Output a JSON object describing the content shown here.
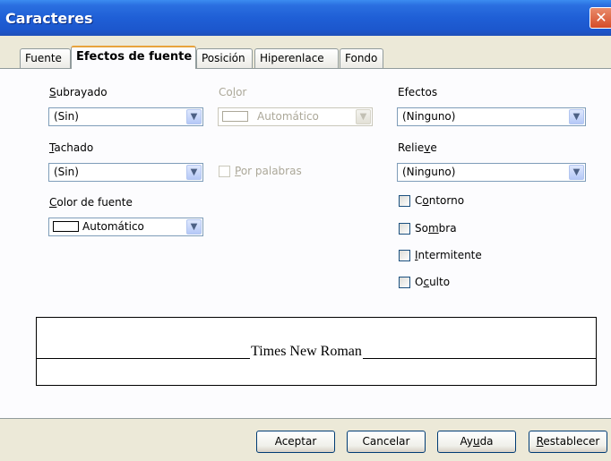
{
  "window": {
    "title": "Caracteres",
    "close_icon": "close-icon"
  },
  "tabs": [
    {
      "label": "Fuente",
      "active": false
    },
    {
      "label": "Efectos de fuente",
      "active": true
    },
    {
      "label": "Posición",
      "active": false
    },
    {
      "label": "Hiperenlace",
      "active": false
    },
    {
      "label": "Fondo",
      "active": false
    }
  ],
  "fields": {
    "underline": {
      "label_u": "S",
      "label_rest": "ubrayado",
      "value": "(Sin)"
    },
    "color": {
      "label_a": "Co",
      "label_u": "l",
      "label_b": "or",
      "value": "Automático",
      "disabled": true
    },
    "effects": {
      "label": "Efectos",
      "value": "(Ninguno)"
    },
    "strikeout": {
      "label_u": "T",
      "label_rest": "achado",
      "value": "(Sin)"
    },
    "by_words": {
      "label_u": "P",
      "label_rest": "or palabras",
      "checked": false,
      "disabled": true
    },
    "relief": {
      "label_a": "Relie",
      "label_u": "v",
      "label_b": "e",
      "value": "(Ninguno)"
    },
    "font_color": {
      "label_u": "C",
      "label_rest": "olor de fuente",
      "value": "Automático"
    },
    "checks": [
      {
        "label_a": "C",
        "label_u": "o",
        "label_b": "ntorno",
        "checked": false
      },
      {
        "label_a": "So",
        "label_u": "m",
        "label_b": "bra",
        "checked": false
      },
      {
        "label_a": "",
        "label_u": "I",
        "label_b": "ntermitente",
        "checked": false
      },
      {
        "label_a": "O",
        "label_u": "c",
        "label_b": "ulto",
        "checked": false
      }
    ]
  },
  "preview": {
    "text": "Times New Roman"
  },
  "buttons": {
    "ok": "Aceptar",
    "cancel": "Cancelar",
    "help_a": "Ay",
    "help_u": "u",
    "help_b": "da",
    "reset_u": "R",
    "reset_rest": "establecer"
  }
}
